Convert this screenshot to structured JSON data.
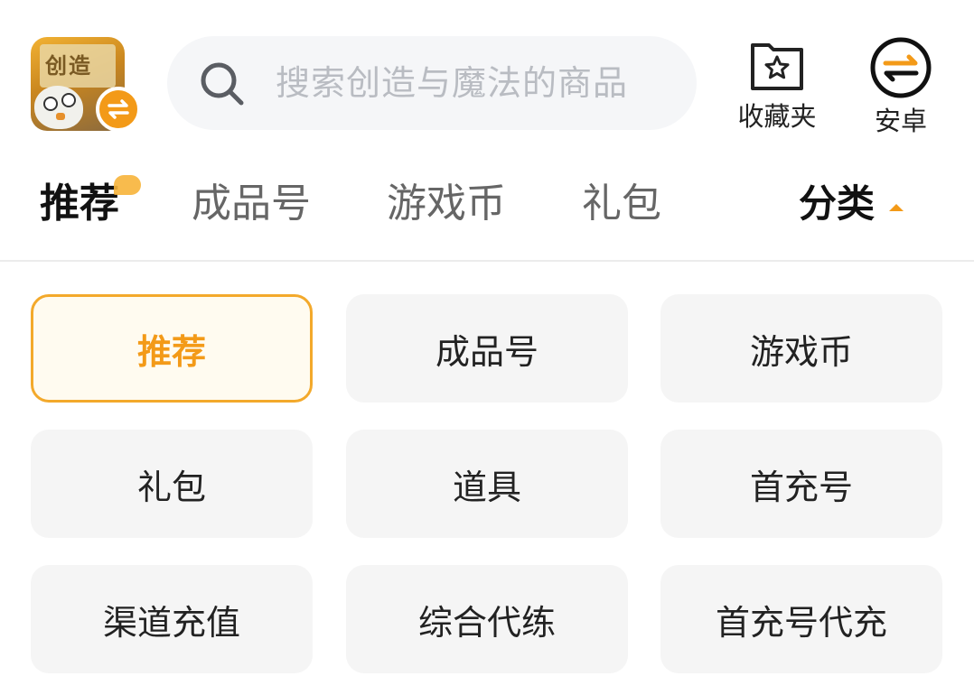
{
  "header": {
    "app_icon_text": "创造",
    "search_placeholder": "搜索创造与魔法的商品",
    "favorites_label": "收藏夹",
    "platform_label": "安卓",
    "accent_color": "#f39a18"
  },
  "tabs": [
    {
      "label": "推荐",
      "active": true
    },
    {
      "label": "成品号",
      "active": false
    },
    {
      "label": "游戏币",
      "active": false
    },
    {
      "label": "礼包",
      "active": false
    }
  ],
  "category_toggle": {
    "label": "分类"
  },
  "categories": [
    {
      "label": "推荐",
      "selected": true
    },
    {
      "label": "成品号",
      "selected": false
    },
    {
      "label": "游戏币",
      "selected": false
    },
    {
      "label": "礼包",
      "selected": false
    },
    {
      "label": "道具",
      "selected": false
    },
    {
      "label": "首充号",
      "selected": false
    },
    {
      "label": "渠道充值",
      "selected": false
    },
    {
      "label": "综合代练",
      "selected": false
    },
    {
      "label": "首充号代充",
      "selected": false
    }
  ]
}
